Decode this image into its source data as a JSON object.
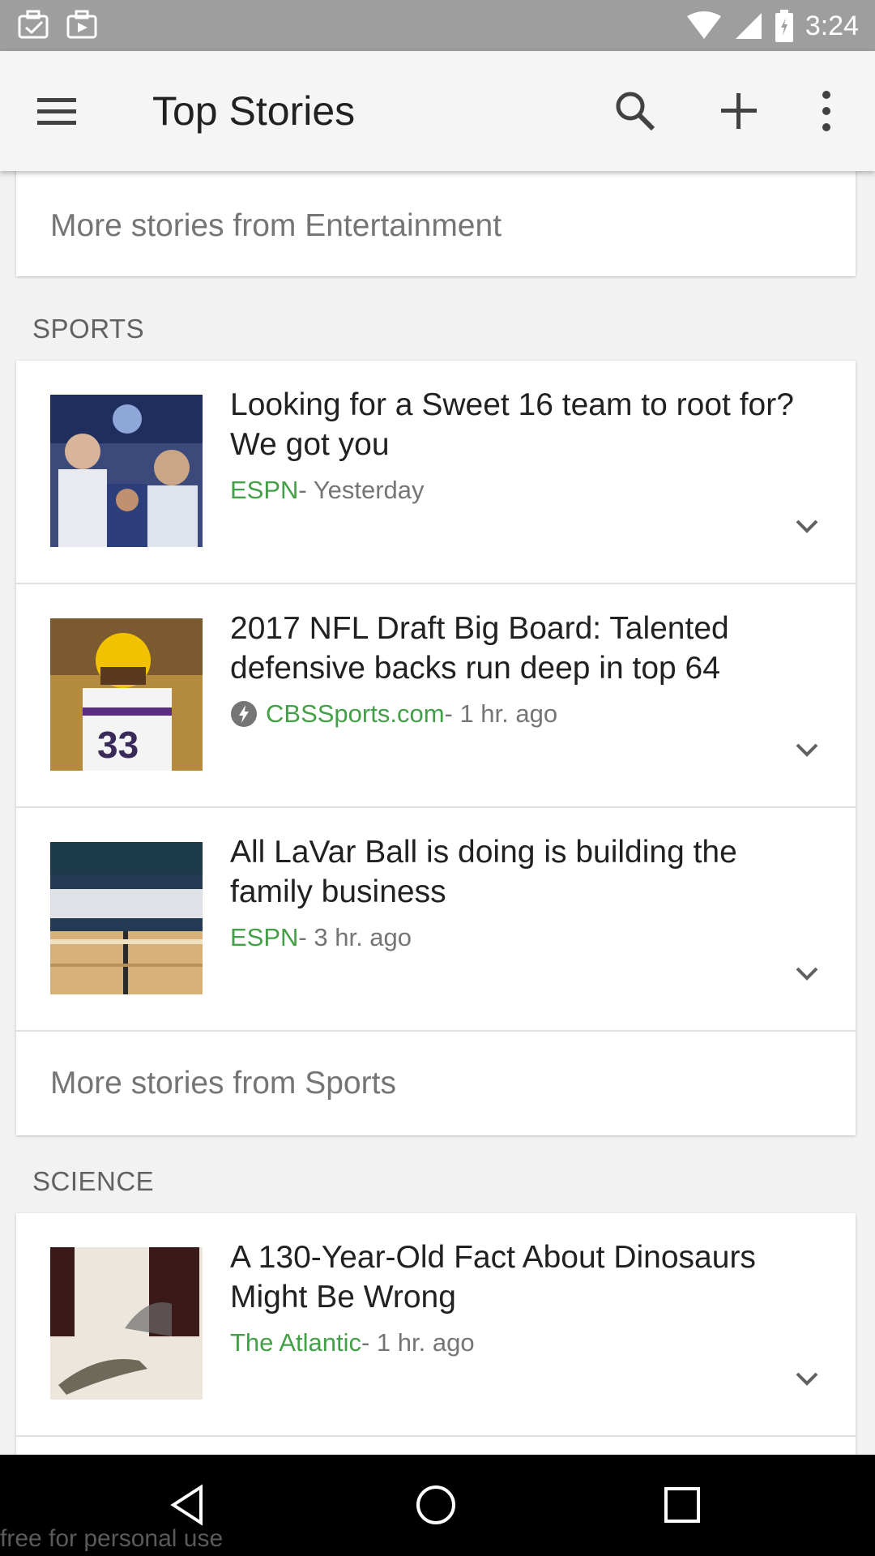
{
  "status_bar": {
    "time": "3:24",
    "icons": [
      "notification-icon",
      "notification-icon",
      "wifi-icon",
      "signal-icon",
      "battery-icon"
    ]
  },
  "app_bar": {
    "title": "Top Stories",
    "icons": [
      "menu-icon",
      "search-icon",
      "add-icon",
      "more-vert-icon"
    ]
  },
  "sections": {
    "entertainment": {
      "more_label": "More stories from Entertainment"
    },
    "sports": {
      "label": "SPORTS",
      "stories": [
        {
          "headline": "Looking for a Sweet 16 team to root for? We got you",
          "source": "ESPN",
          "time": " - Yesterday"
        },
        {
          "headline": "2017 NFL Draft Big Board: Talented defensive backs run deep in top 64",
          "source": "CBSSports.com",
          "time": " - 1 hr. ago"
        },
        {
          "headline": "All LaVar Ball is doing is building the family business",
          "source": "ESPN",
          "time": " - 3 hr. ago"
        }
      ],
      "more_label": "More stories from Sports"
    },
    "science": {
      "label": "SCIENCE",
      "stories": [
        {
          "headline": "A 130-Year-Old Fact About Dinosaurs Might Be Wrong",
          "source": "The Atlantic",
          "time": " - 1 hr. ago"
        }
      ]
    }
  },
  "nav_bar": {
    "icons": [
      "back-icon",
      "home-icon",
      "recents-icon"
    ]
  },
  "watermark": "free for personal use",
  "colors": {
    "source_green": "#43a047",
    "status_bar": "#9e9e9e",
    "app_bar": "#f5f5f5"
  }
}
